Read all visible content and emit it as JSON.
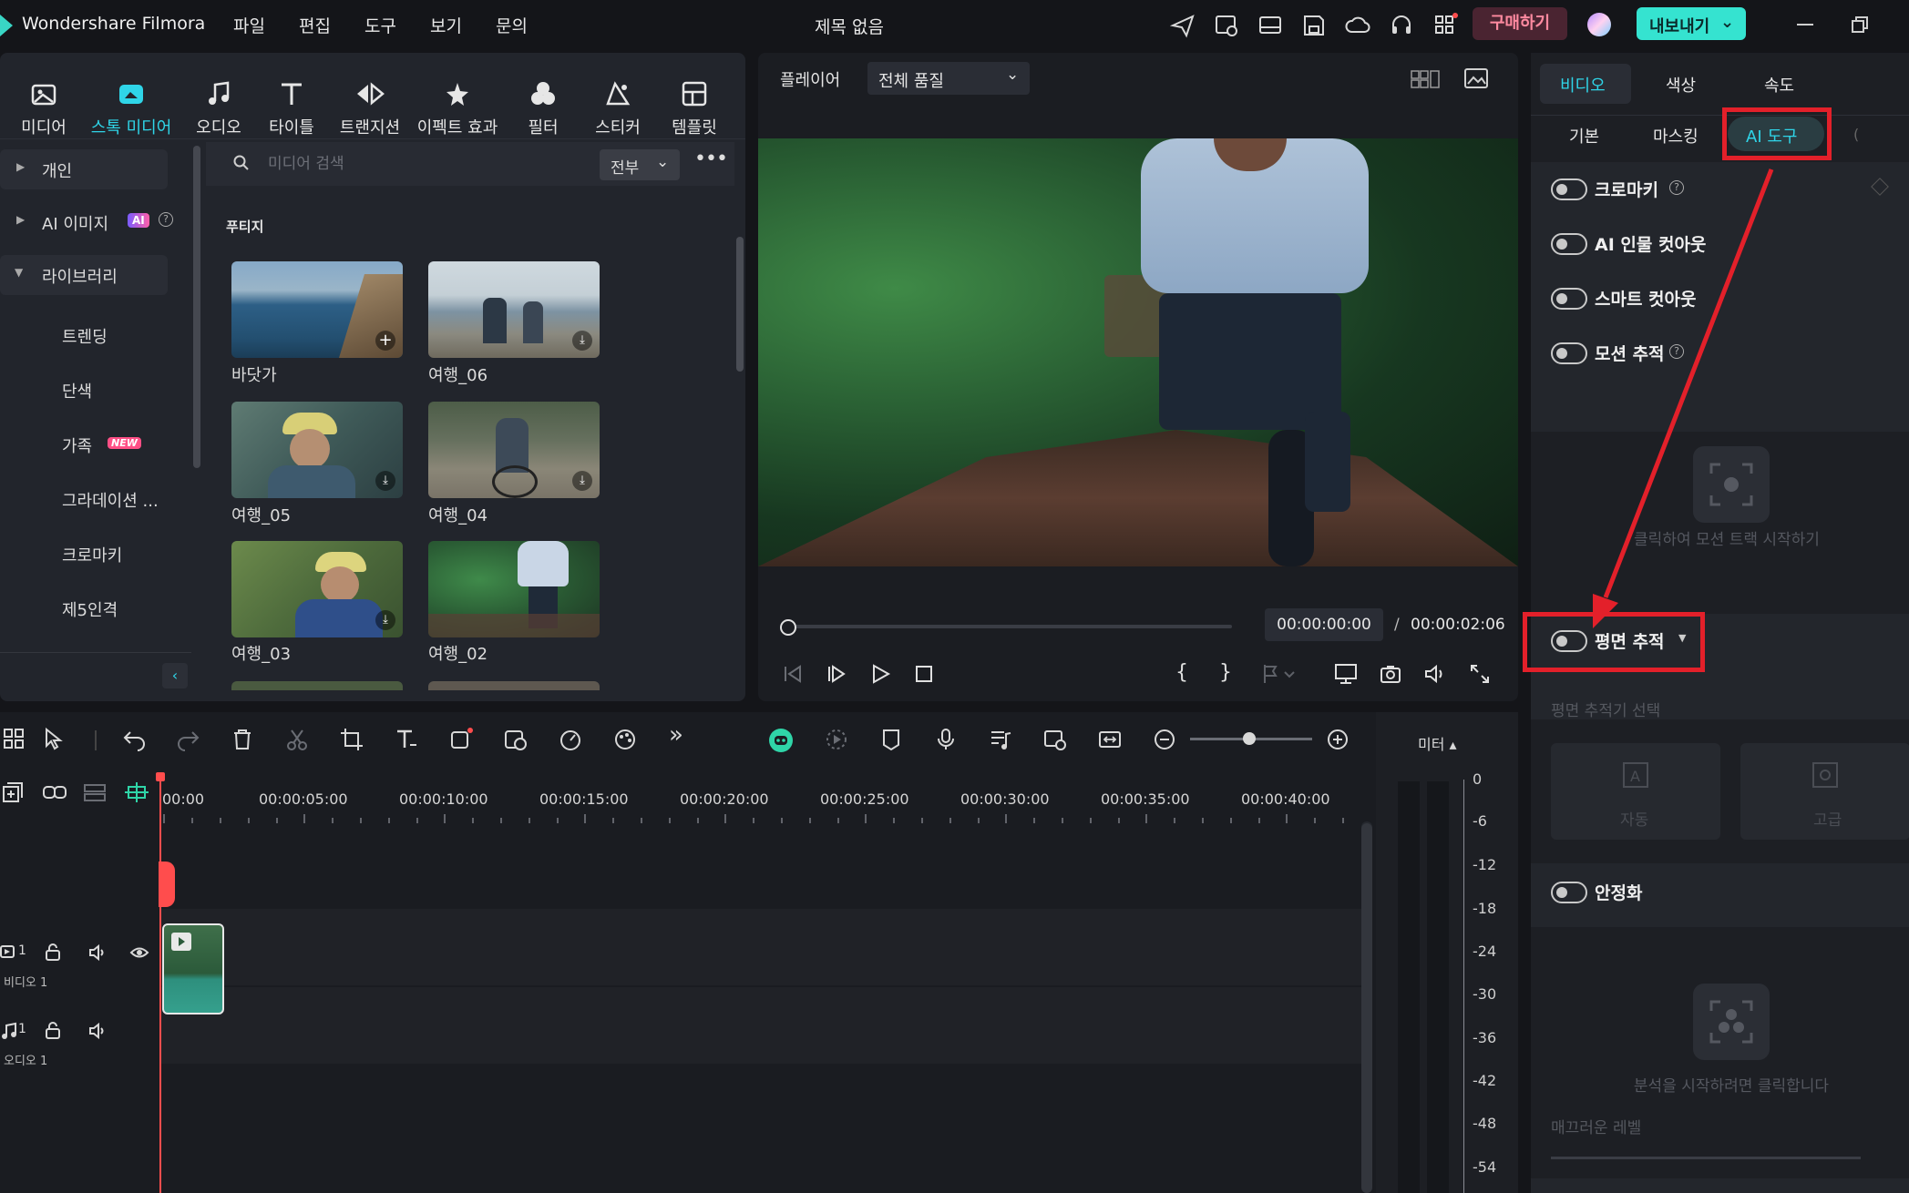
{
  "app": {
    "name": "Wondershare Filmora",
    "title": "제목 없음"
  },
  "menu": [
    "파일",
    "편집",
    "도구",
    "보기",
    "문의"
  ],
  "header_buttons": {
    "buy": "구매하기",
    "export": "내보내기"
  },
  "colors": {
    "accent": "#2fd5e8",
    "buy_bg": "#4a2431",
    "buy_text": "#ff8aa0",
    "export_bg": "#35e3d0",
    "highlight": "#e3202a"
  },
  "categories": [
    {
      "label": "미디어",
      "icon": "media-icon"
    },
    {
      "label": "스톡 미디어",
      "icon": "stock-media-icon",
      "active": true
    },
    {
      "label": "오디오",
      "icon": "audio-icon"
    },
    {
      "label": "타이틀",
      "icon": "title-icon"
    },
    {
      "label": "트랜지션",
      "icon": "transition-icon"
    },
    {
      "label": "이펙트 효과",
      "icon": "effects-icon"
    },
    {
      "label": "필터",
      "icon": "filter-icon"
    },
    {
      "label": "스티커",
      "icon": "sticker-icon"
    },
    {
      "label": "템플릿",
      "icon": "template-icon"
    }
  ],
  "tree": {
    "personal": "개인",
    "ai_image": "AI 이미지",
    "ai_badge": "AI",
    "library": "라이브러리",
    "items": [
      "트렌딩",
      "단색",
      "가족",
      "그라데이션 ...",
      "크로마키",
      "제5인격"
    ],
    "new_badge": "NEW"
  },
  "search": {
    "placeholder": "미디어 검색",
    "filter": "전부"
  },
  "section_title": "푸티지",
  "thumbnails": [
    "바닷가",
    "여행_06",
    "여행_05",
    "여행_04",
    "여행_03",
    "여행_02"
  ],
  "player": {
    "label": "플레이어",
    "quality": "전체 품질",
    "current_time": "00:00:00:00",
    "separator": "/",
    "total_time": "00:00:02:06"
  },
  "right_panel": {
    "tabs": [
      "비디오",
      "색상",
      "속도"
    ],
    "subtabs": [
      "기본",
      "마스킹",
      "AI 도구"
    ],
    "features": {
      "chroma": "크로마키",
      "ai_cutout": "AI 인물 컷아웃",
      "smart_cutout": "스마트 컷아웃",
      "motion_tracking": "모션 추적",
      "motion_hint": "클릭하여 모션 트랙 시작하기",
      "planar_tracking": "평면 추적",
      "planar_select": "평면 추적기 선택",
      "auto": "자동",
      "advanced": "고급",
      "stabilize": "안정화",
      "analyze_hint": "분석을 시작하려면 클릭합니다",
      "smooth_level": "매끄러운 레벨"
    }
  },
  "timeline": {
    "ruler": [
      "00:00",
      "00:00:05:00",
      "00:00:10:00",
      "00:00:15:00",
      "00:00:20:00",
      "00:00:25:00",
      "00:00:30:00",
      "00:00:35:00",
      "00:00:40:00"
    ],
    "meter_label": "미터 ▴",
    "meter_scale": [
      "0",
      "-6",
      "-12",
      "-18",
      "-24",
      "-30",
      "-36",
      "-42",
      "-48",
      "-54"
    ],
    "video_track": "비디오 1",
    "video_track_num": "1",
    "audio_track": "오디오 1",
    "audio_track_num": "1"
  }
}
